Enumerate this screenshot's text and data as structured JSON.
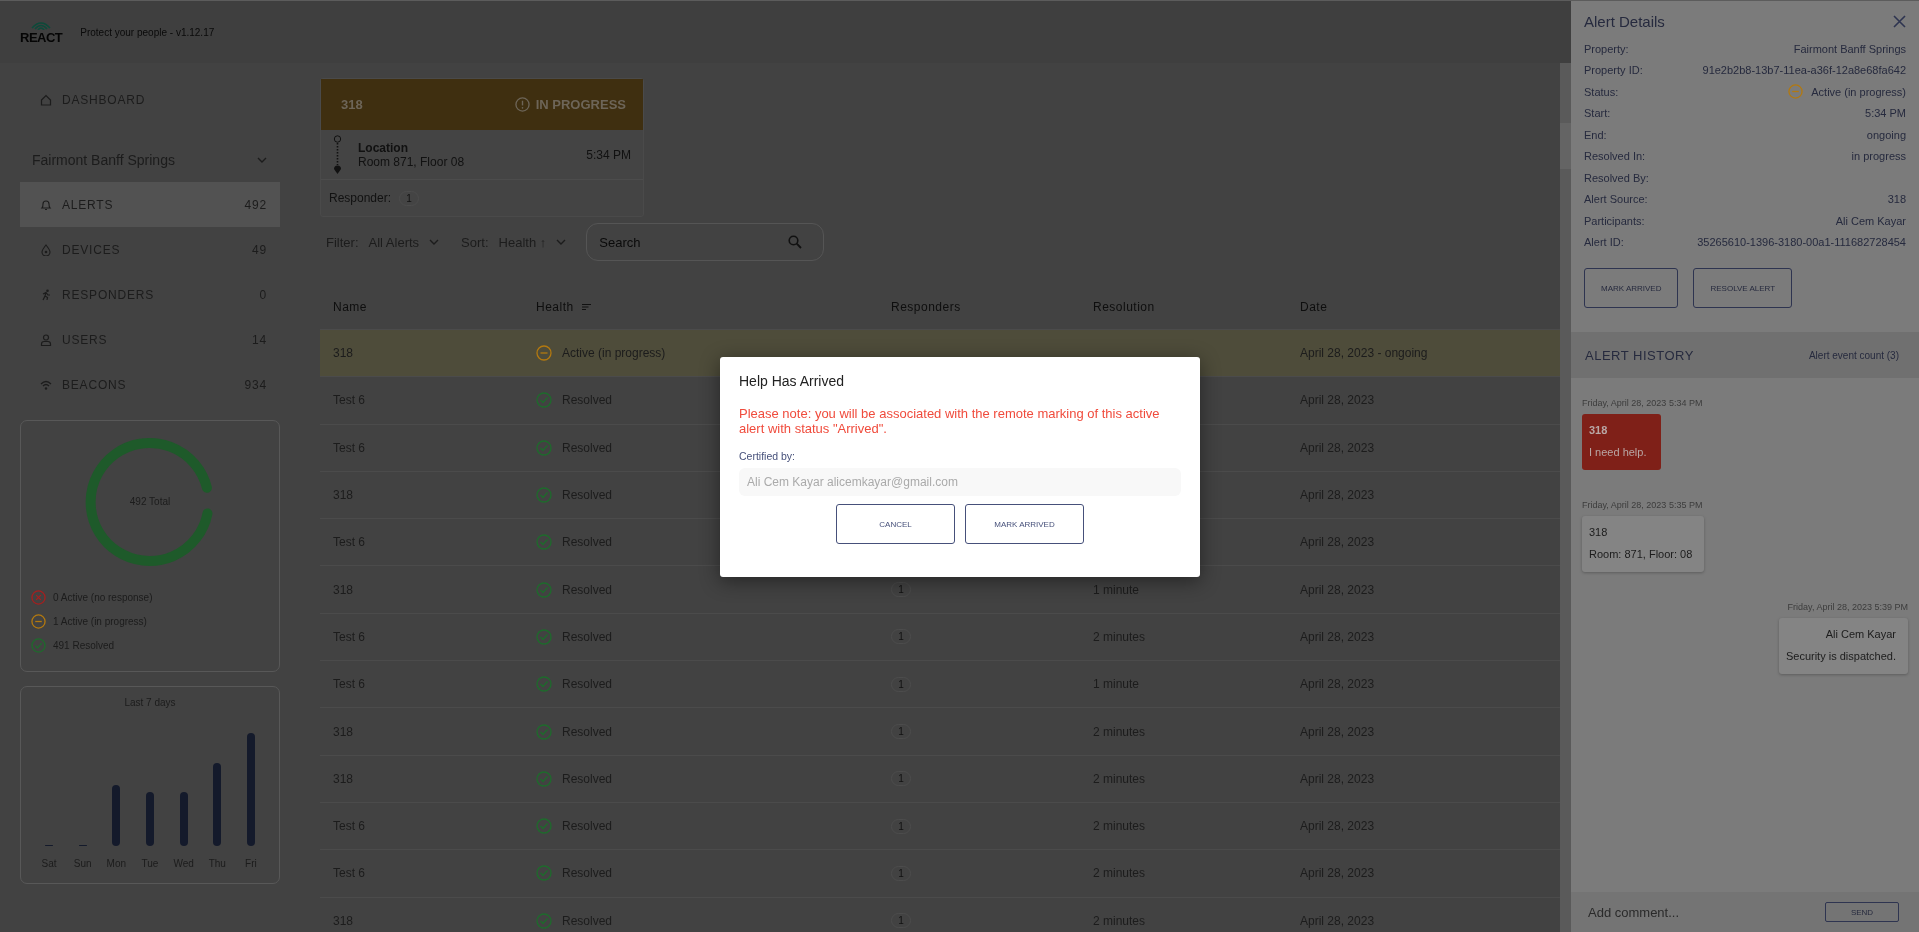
{
  "app": {
    "logo": "REACT",
    "tagline": "Protect your people - v1.12.17"
  },
  "sidebar": {
    "dashboard": "DASHBOARD",
    "property": "Fairmont Banff Springs",
    "items": [
      {
        "label": "ALERTS",
        "count": "492",
        "selected": true
      },
      {
        "label": "DEVICES",
        "count": "49",
        "selected": false
      },
      {
        "label": "RESPONDERS",
        "count": "0",
        "selected": false
      },
      {
        "label": "USERS",
        "count": "14",
        "selected": false
      },
      {
        "label": "BEACONS",
        "count": "934",
        "selected": false
      }
    ]
  },
  "summary": {
    "total": "492 Total",
    "legend": [
      {
        "kind": "no_response",
        "label": "0 Active (no response)"
      },
      {
        "kind": "in_progress",
        "label": "1 Active (in progress)"
      },
      {
        "kind": "resolved",
        "label": "491 Resolved"
      }
    ]
  },
  "weekly": {
    "title": "Last 7 days",
    "days": [
      "Sat",
      "Sun",
      "Mon",
      "Tue",
      "Wed",
      "Thu",
      "Fri"
    ]
  },
  "alert_card": {
    "name": "318",
    "status": "IN PROGRESS",
    "location_label": "Location",
    "location": "Room 871, Floor 08",
    "time": "5:34 PM",
    "responder_label": "Responder:",
    "responders": "1"
  },
  "toolbar": {
    "filter_label": "Filter:",
    "filter": "All Alerts",
    "sort_label": "Sort:",
    "sort": "Health ↑",
    "search_placeholder": "Search"
  },
  "table": {
    "columns": [
      "Name",
      "Health",
      "Responders",
      "Resolution",
      "Date"
    ],
    "rows": [
      {
        "name": "318",
        "kind": "in_progress",
        "health": "Active (in progress)",
        "date": "April 28, 2023 - ongoing",
        "selected": true
      },
      {
        "name": "Test 6",
        "kind": "resolved",
        "health": "Resolved",
        "date": "April 28, 2023",
        "selected": false
      },
      {
        "name": "Test 6",
        "kind": "resolved",
        "health": "Resolved",
        "date": "April 28, 2023",
        "selected": false
      },
      {
        "name": "318",
        "kind": "resolved",
        "health": "Resolved",
        "date": "April 28, 2023",
        "selected": false
      },
      {
        "name": "Test 6",
        "kind": "resolved",
        "health": "Resolved",
        "date": "April 28, 2023",
        "selected": false
      },
      {
        "name": "318",
        "kind": "resolved",
        "health": "Resolved",
        "responders": "1",
        "resolution": "1 minute",
        "date": "April 28, 2023",
        "selected": false
      },
      {
        "name": "Test 6",
        "kind": "resolved",
        "health": "Resolved",
        "responders": "1",
        "resolution": "2 minutes",
        "date": "April 28, 2023",
        "selected": false
      },
      {
        "name": "Test 6",
        "kind": "resolved",
        "health": "Resolved",
        "responders": "1",
        "resolution": "1 minute",
        "date": "April 28, 2023",
        "selected": false
      },
      {
        "name": "318",
        "kind": "resolved",
        "health": "Resolved",
        "responders": "1",
        "resolution": "2 minutes",
        "date": "April 28, 2023",
        "selected": false
      },
      {
        "name": "318",
        "kind": "resolved",
        "health": "Resolved",
        "responders": "1",
        "resolution": "2 minutes",
        "date": "April 28, 2023",
        "selected": false
      },
      {
        "name": "Test 6",
        "kind": "resolved",
        "health": "Resolved",
        "responders": "1",
        "resolution": "2 minutes",
        "date": "April 28, 2023",
        "selected": false
      },
      {
        "name": "Test 6",
        "kind": "resolved",
        "health": "Resolved",
        "responders": "1",
        "resolution": "2 minutes",
        "date": "April 28, 2023",
        "selected": false
      },
      {
        "name": "318",
        "kind": "resolved",
        "health": "Resolved",
        "responders": "1",
        "resolution": "2 minutes",
        "date": "April 28, 2023",
        "selected": false
      }
    ]
  },
  "details": {
    "title": "Alert Details",
    "fields": [
      {
        "label": "Property:",
        "value": "Fairmont Banff Springs"
      },
      {
        "label": "Property ID:",
        "value": "91e2b2b8-13b7-11ea-a36f-12a8e68fa642"
      },
      {
        "label": "Status:",
        "value": "Active (in progress)",
        "kind": "in_progress"
      },
      {
        "label": "Start:",
        "value": "5:34 PM"
      },
      {
        "label": "End:",
        "value": "ongoing"
      },
      {
        "label": "Resolved In:",
        "value": "in progress"
      },
      {
        "label": "Resolved By:"
      },
      {
        "label": "Alert Source:",
        "value": "318"
      },
      {
        "label": "Participants:",
        "value": "Ali Cem Kayar"
      },
      {
        "label": "Alert ID:",
        "value": "35265610-1396-3180-00a1-111682728454"
      }
    ],
    "buttons": [
      "MARK ARRIVED",
      "RESOLVE ALERT"
    ]
  },
  "history": {
    "title": "ALERT HISTORY",
    "count": "Alert event count (3)",
    "events": [
      {
        "kind": "alert",
        "time": "Friday, April 28, 2023 5:34 PM",
        "author": "318",
        "text": "I need help."
      },
      {
        "kind": "info",
        "time": "Friday, April 28, 2023 5:35 PM",
        "author": "318",
        "text": "Room: 871, Floor: 08"
      },
      {
        "kind": "reply",
        "time": "Friday, April 28, 2023 5:39 PM",
        "author": "Ali Cem Kayar",
        "text": "Security is dispatched."
      }
    ]
  },
  "comment": {
    "placeholder": "Add comment...",
    "button": "SEND"
  },
  "modal": {
    "title": "Help Has Arrived",
    "note": "Please note: you will be associated with the remote marking of this active alert with status \"Arrived\".",
    "certified_label": "Certified by:",
    "certified_value": "Ali Cem Kayar alicemkayar@gmail.com",
    "buttons": [
      "CANCEL",
      "MARK ARRIVED"
    ]
  }
}
